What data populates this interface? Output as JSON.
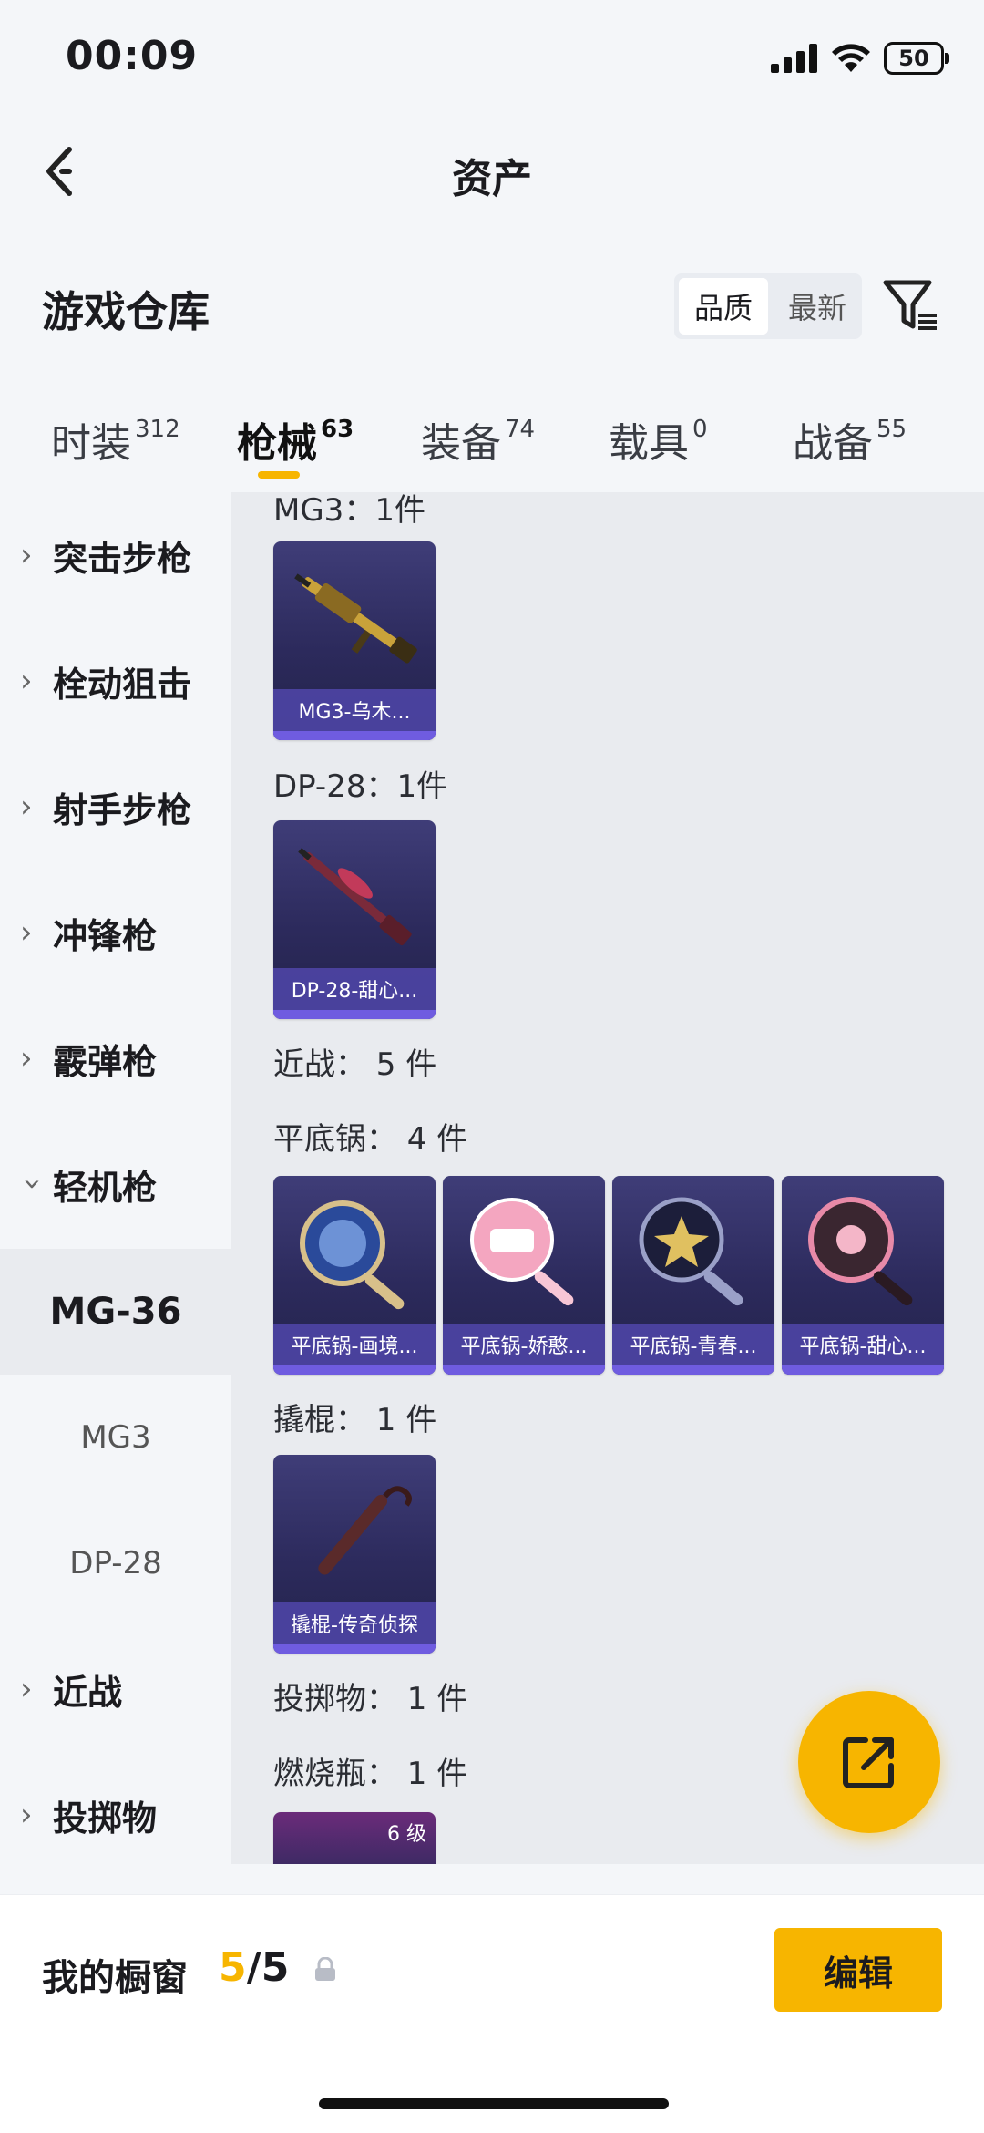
{
  "status_bar": {
    "time": "00:09",
    "battery": "50"
  },
  "nav": {
    "title": "资产"
  },
  "warehouse": {
    "title": "游戏仓库",
    "sort_options": [
      "品质",
      "最新"
    ]
  },
  "tabs": [
    {
      "label": "时装",
      "count": "312"
    },
    {
      "label": "枪械",
      "count": "63"
    },
    {
      "label": "装备",
      "count": "74"
    },
    {
      "label": "载具",
      "count": "0"
    },
    {
      "label": "战备",
      "count": "55"
    }
  ],
  "sidebar": {
    "items": [
      "突击步枪",
      "栓动狙击",
      "射手步枪",
      "冲锋枪",
      "霰弹枪",
      "轻机枪"
    ],
    "selected": "MG-36",
    "subs": [
      "MG3",
      "DP-28"
    ],
    "more": [
      "近战",
      "投掷物"
    ]
  },
  "content": {
    "mg3_label": "MG3：1件",
    "mg3_card": "MG3-乌木...",
    "dp28_label": "DP-28：1件",
    "dp28_card": "DP-28-甜心...",
    "melee_label": "近战： 5 件",
    "pan_label": "平底锅： 4 件",
    "pan_cards": [
      "平底锅-画境...",
      "平底锅-娇憨...",
      "平底锅-青春...",
      "平底锅-甜心..."
    ],
    "crowbar_label": "撬棍： 1 件",
    "crowbar_card": "撬棍-传奇侦探",
    "throwable_label": "投掷物： 1 件",
    "molotov_label": "燃烧瓶： 1 件",
    "molotov_level": "6 级"
  },
  "bottom": {
    "showcase_label": "我的橱窗",
    "showcase_used": "5",
    "showcase_total": "/5",
    "edit_label": "编辑"
  },
  "colors": {
    "accent": "#f7b500",
    "card_bg": "#2c2a5c",
    "card_band": "#6f5ce0"
  }
}
